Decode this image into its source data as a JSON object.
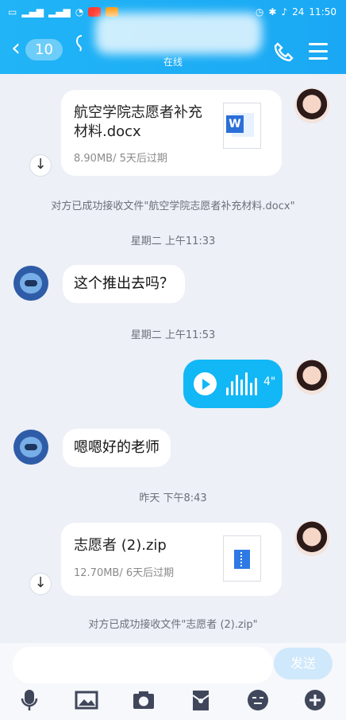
{
  "status_bar": {
    "time": "11:50",
    "battery": "24"
  },
  "header": {
    "back_count": "10",
    "online": "在线",
    "title_blurred": "…"
  },
  "messages": {
    "file1_name": "航空学院志愿者补充材料.docx",
    "file1_meta": "8.90MB/ 5天后过期",
    "receipt1": "对方已成功接收文件\"航空学院志愿者补充材料.docx\"",
    "time1": "星期二 上午11:33",
    "text1": "这个推出去吗？",
    "time2": "星期二 上午11:53",
    "voice_duration": "4\"",
    "text2": "嗯嗯好的老师",
    "time3": "昨天 下午8:43",
    "file2_name": "志愿者 (2).zip",
    "file2_meta": "12.70MB/ 6天后过期",
    "receipt2": "对方已成功接收文件\"志愿者 (2).zip\""
  },
  "input": {
    "placeholder": "",
    "send_label": "发送"
  },
  "icons": [
    "mic-icon",
    "image-icon",
    "camera-icon",
    "red-packet-icon",
    "emoji-icon",
    "plus-icon"
  ]
}
